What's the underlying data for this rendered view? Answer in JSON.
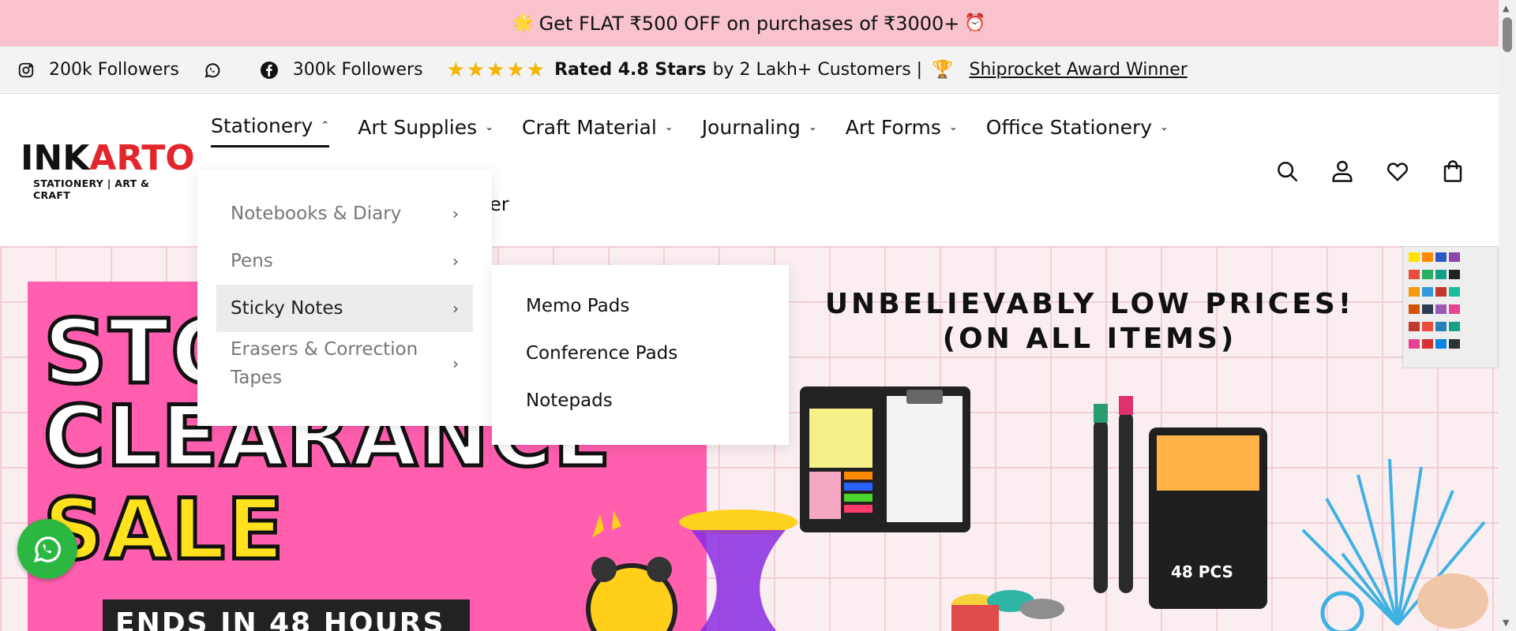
{
  "announcement": {
    "left_emoji": "🌟",
    "text": "Get FLAT ₹500 OFF on purchases of ₹3000+",
    "right_emoji": "⏰"
  },
  "social_bar": {
    "instagram_followers": "200k Followers",
    "facebook_followers": "300k Followers",
    "stars": "★★★★★",
    "rating_bold": "Rated 4.8 Stars",
    "rating_rest": "by 2 Lakh+ Customers |",
    "trophy": "🏆",
    "award_link": "Shiprocket Award Winner"
  },
  "logo": {
    "brand_ink": "INK",
    "brand_arto": "ARTO",
    "tagline": "STATIONERY | ART & CRAFT"
  },
  "nav": {
    "items": [
      {
        "label": "Stationery",
        "chevron": "⌃"
      },
      {
        "label": "Art Supplies",
        "chevron": "⌄"
      },
      {
        "label": "Craft Material",
        "chevron": "⌄"
      },
      {
        "label": "Journaling",
        "chevron": "⌄"
      },
      {
        "label": "Art Forms",
        "chevron": "⌄"
      },
      {
        "label": "Office Stationery",
        "chevron": "⌄"
      }
    ],
    "overflow_text": "er"
  },
  "dropdown": {
    "items": [
      {
        "label": "Notebooks & Diary",
        "arrow": "›"
      },
      {
        "label": "Pens",
        "arrow": "›"
      },
      {
        "label": "Sticky Notes",
        "arrow": "›"
      },
      {
        "label": "Erasers & Correction Tapes",
        "arrow": "›"
      }
    ],
    "submenu": [
      "Memo Pads",
      "Conference Pads",
      "Notepads"
    ]
  },
  "hero": {
    "word1": "STO",
    "word2": "CLEARANCE",
    "word3": "SALE",
    "ends_label": "ENDS IN 48 HOURS",
    "headline_line1": "UNBELIEVABLY LOW PRICES!",
    "headline_line2": "(ON ALL ITEMS)",
    "marker_box_label": "48 PCS"
  },
  "colors": {
    "announcement_bg": "#f8c3cd",
    "accent_red": "#e3262b",
    "hero_pink": "#ff5fae",
    "whatsapp_green": "#2bb741"
  }
}
